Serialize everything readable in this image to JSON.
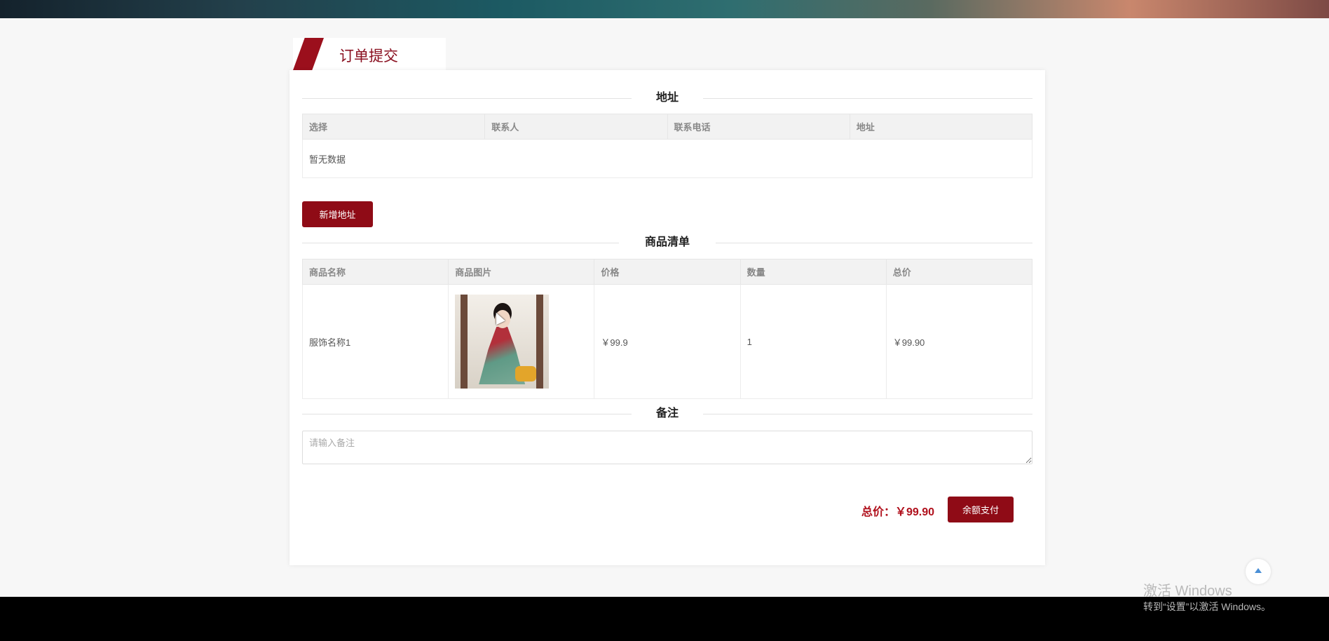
{
  "page": {
    "title": "订单提交"
  },
  "address_section": {
    "heading": "地址",
    "columns": [
      "选择",
      "联系人",
      "联系电话",
      "地址"
    ],
    "empty_text": "暂无数据",
    "add_button": "新增地址"
  },
  "goods_section": {
    "heading": "商品清单",
    "columns": [
      "商品名称",
      "商品图片",
      "价格",
      "数量",
      "总价"
    ],
    "rows": [
      {
        "name": "服饰名称1",
        "image_alt": "product-photo",
        "price": "￥99.9",
        "quantity": "1",
        "total": "￥99.90"
      }
    ]
  },
  "remark_section": {
    "heading": "备注",
    "placeholder": "请输入备注",
    "value": ""
  },
  "checkout": {
    "total_label": "总价：￥99.90",
    "pay_button": "余额支付"
  },
  "windows_watermark": {
    "line1": "激活 Windows",
    "line2": "转到“设置”以激活 Windows。"
  },
  "colors": {
    "accent": "#8f0b16",
    "price_red": "#b0101c"
  }
}
